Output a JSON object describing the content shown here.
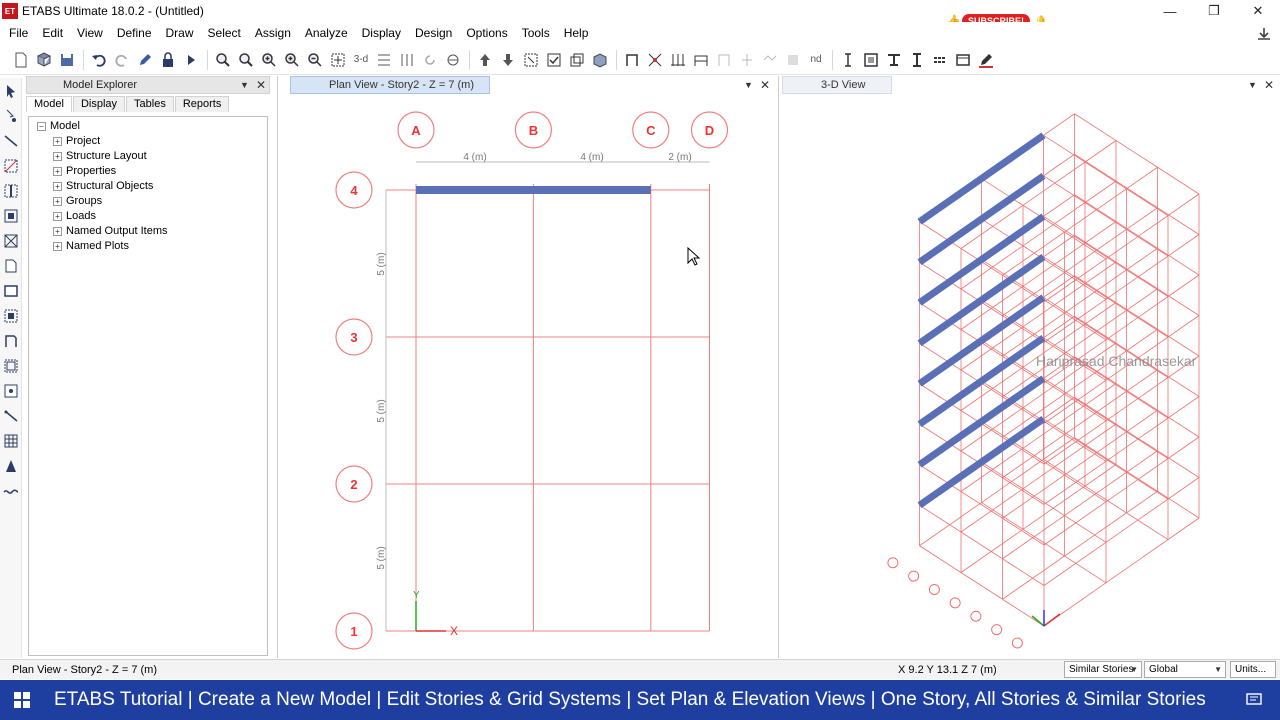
{
  "window": {
    "title": "ETABS Ultimate 18.0.2 - (Untitled)",
    "logo_text": "ET",
    "min": "—",
    "restore": "❐",
    "close": "✕"
  },
  "overlay": {
    "subscribe_label": "SUBSCRIBE!",
    "watermark": "Hariprasad Chandrasekar"
  },
  "menu": [
    "File",
    "Edit",
    "View",
    "Define",
    "Draw",
    "Select",
    "Assign",
    "Analyze",
    "Display",
    "Design",
    "Options",
    "Tools",
    "Help"
  ],
  "toolbar": {
    "view_3d_label": "3-d",
    "nd_label": "nd"
  },
  "explorer": {
    "title": "Model Explorer",
    "tabs": [
      "Model",
      "Display",
      "Tables",
      "Reports"
    ],
    "root": "Model",
    "items": [
      "Project",
      "Structure Layout",
      "Properties",
      "Structural Objects",
      "Groups",
      "Loads",
      "Named Output Items",
      "Named Plots"
    ]
  },
  "plan_view": {
    "title": "Plan View - Story2 - Z = 7 (m)",
    "grid_x": [
      {
        "label": "A",
        "pos": 0
      },
      {
        "label": "B",
        "pos": 4
      },
      {
        "label": "C",
        "pos": 8
      },
      {
        "label": "D",
        "pos": 10
      }
    ],
    "grid_y": [
      {
        "label": "1",
        "pos": 0
      },
      {
        "label": "2",
        "pos": 5
      },
      {
        "label": "3",
        "pos": 10
      },
      {
        "label": "4",
        "pos": 15
      }
    ],
    "x_spacing_labels": [
      "4 (m)",
      "4 (m)",
      "2 (m)"
    ],
    "y_spacing_labels": [
      "5 (m)",
      "5 (m)",
      "5 (m)"
    ],
    "axis_x": "X",
    "axis_y": "Y",
    "selected_beam": {
      "from": "A",
      "to": "C",
      "grid": "4"
    },
    "grid_color": "#f08080",
    "beam_color": "#5a6fb5"
  },
  "view_3d": {
    "title": "3-D View",
    "stories": 8,
    "grid_color": "#f07070",
    "beam_color": "#5a6fb5"
  },
  "status": {
    "view_label": "Plan View - Story2 - Z = 7 (m)",
    "coords": "X 9.2  Y 13.1  Z 7 (m)",
    "stories_option": "Similar Stories",
    "coord_system": "Global",
    "units_label": "Units..."
  },
  "banner": "ETABS Tutorial | Create a New Model | Edit Stories & Grid Systems | Set Plan & Elevation Views | One Story, All Stories & Similar Stories"
}
